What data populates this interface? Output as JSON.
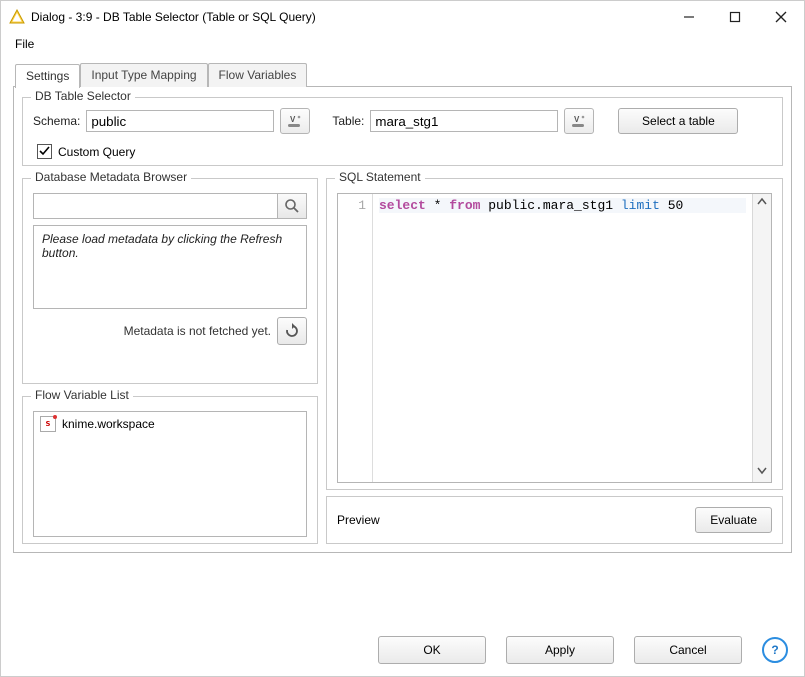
{
  "titlebar": {
    "title": "Dialog - 3:9 - DB Table Selector (Table or SQL Query)"
  },
  "menubar": {
    "file": "File"
  },
  "tabs": {
    "settings": "Settings",
    "input_type_mapping": "Input Type Mapping",
    "flow_variables": "Flow Variables"
  },
  "selector_group": {
    "title": "DB Table Selector",
    "schema_label": "Schema:",
    "schema_value": "public",
    "table_label": "Table:",
    "table_value": "mara_stg1",
    "select_btn": "Select a table",
    "custom_query_label": "Custom Query",
    "custom_query_checked": true
  },
  "metadata_group": {
    "title": "Database Metadata Browser",
    "search_value": "",
    "message": "Please load metadata by clicking the Refresh button.",
    "status": "Metadata is not fetched yet."
  },
  "flowvar_group": {
    "title": "Flow Variable List",
    "items": [
      {
        "icon": "s",
        "label": "knime.workspace"
      }
    ]
  },
  "sql_group": {
    "title": "SQL Statement",
    "line_no": "1",
    "tokens": {
      "select": "select",
      "star": " * ",
      "from": "from",
      "rest": " public.mara_stg1 ",
      "limit": "limit",
      "num": " 50"
    }
  },
  "preview": {
    "label": "Preview",
    "evaluate": "Evaluate"
  },
  "buttons": {
    "ok": "OK",
    "apply": "Apply",
    "cancel": "Cancel"
  }
}
